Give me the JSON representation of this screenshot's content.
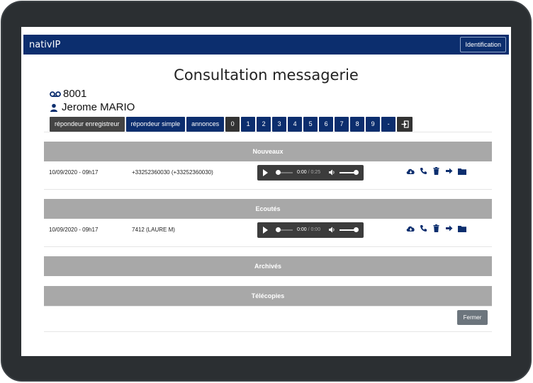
{
  "navbar": {
    "brand": "nativIP",
    "identification_label": "Identification"
  },
  "page": {
    "title": "Consultation messagerie",
    "extension": "8001",
    "user_name": "Jerome MARIO"
  },
  "tabs": [
    {
      "label": "répondeur enregistreur",
      "active": true
    },
    {
      "label": "répondeur simple",
      "active": false
    },
    {
      "label": "annonces",
      "active": false
    }
  ],
  "number_buttons": [
    "0",
    "1",
    "2",
    "3",
    "4",
    "5",
    "6",
    "7",
    "8",
    "9",
    "-"
  ],
  "sections": {
    "nouveaux": {
      "title": "Nouveaux",
      "messages": [
        {
          "date": "10/09/2020 - 09h17",
          "caller": "+33252360030 (+33252360030)",
          "time_current": "0:00",
          "time_total": "0:25"
        }
      ]
    },
    "ecoutes": {
      "title": "Ecoutés",
      "messages": [
        {
          "date": "10/09/2020 - 09h17",
          "caller": "7412 (LAURE M)",
          "time_current": "0:00",
          "time_total": "0:00"
        }
      ]
    },
    "archives": {
      "title": "Archivés"
    },
    "telecopies": {
      "title": "Télécopies"
    }
  },
  "footer": {
    "close_label": "Fermer"
  },
  "colors": {
    "navy": "#0c2e6e",
    "section_gray": "#a8a8a8",
    "player_bg": "#3c3c3c",
    "close_btn": "#6c757d"
  }
}
